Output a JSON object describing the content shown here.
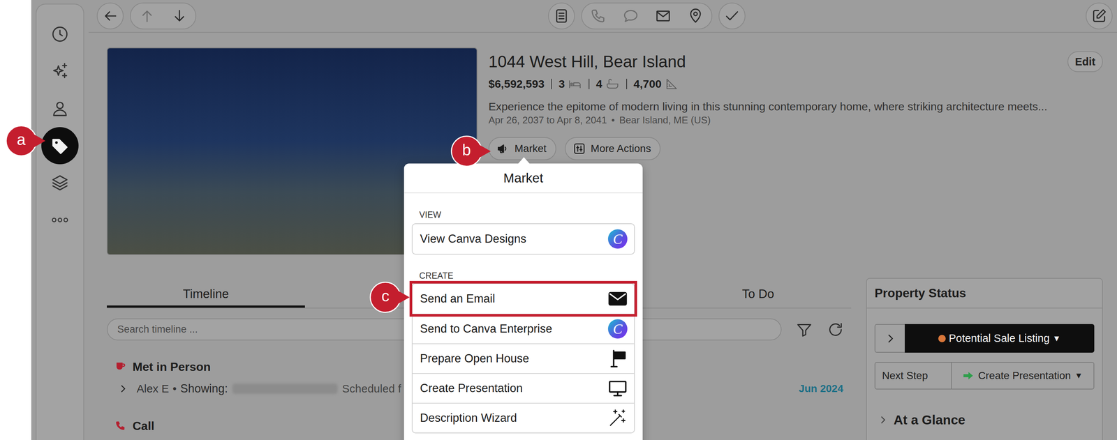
{
  "sidebar": {
    "items": [
      {
        "kind": "history",
        "selected": false
      },
      {
        "kind": "ai",
        "selected": false
      },
      {
        "kind": "contacts",
        "selected": false
      },
      {
        "kind": "properties",
        "selected": true
      },
      {
        "kind": "layers",
        "selected": false
      },
      {
        "kind": "more",
        "selected": false
      }
    ]
  },
  "toolbar": {
    "groups": [
      {
        "buttons": [
          {
            "kind": "back",
            "disabled": false
          }
        ]
      },
      {
        "buttons": [
          {
            "kind": "up",
            "disabled": true
          },
          {
            "kind": "down",
            "disabled": false
          }
        ]
      },
      {
        "buttons": [
          {
            "kind": "notes",
            "disabled": false
          }
        ]
      },
      {
        "buttons": [
          {
            "kind": "phone",
            "disabled": true
          },
          {
            "kind": "chat",
            "disabled": true
          },
          {
            "kind": "mail",
            "disabled": false
          },
          {
            "kind": "pin",
            "disabled": false
          }
        ]
      },
      {
        "buttons": [
          {
            "kind": "check",
            "disabled": false
          }
        ]
      },
      {
        "buttons": [
          {
            "kind": "compose",
            "disabled": false
          }
        ]
      }
    ]
  },
  "property": {
    "title": "1044 West Hill, Bear Island",
    "price": "$6,592,593",
    "stats": [
      {
        "kind": "beds",
        "value": "3"
      },
      {
        "kind": "baths",
        "value": "4"
      },
      {
        "kind": "area",
        "value": "4,700"
      }
    ],
    "description": "Experience the epitome of modern living in this stunning contemporary home, where striking architecture meets...",
    "dates": "Apr 26, 2037 to Apr 8, 2041",
    "separator": "•",
    "location": "Bear Island, ME (US)",
    "edit": "Edit",
    "actions": [
      {
        "kind": "market",
        "label": "Market"
      },
      {
        "kind": "more",
        "label": "More Actions"
      }
    ]
  },
  "tabs": [
    {
      "label": "Timeline",
      "selected": true
    },
    {
      "label": "To Do",
      "selected": false
    }
  ],
  "search": {
    "placeholder": "Search timeline ..."
  },
  "timeline": [
    {
      "kind": "meeting",
      "title": "Met in Person",
      "detail": {
        "expanded": false,
        "who": "Alex E",
        "separator": "•",
        "type": "Showing:",
        "note": "Scheduled f",
        "date": "Jun 2024"
      }
    },
    {
      "kind": "call",
      "title": "Call"
    }
  ],
  "property_status": {
    "title": "Property Status",
    "expanded": false,
    "status": {
      "label": "Potential Sale Listing",
      "caret": "▼",
      "color": "#d9773a"
    },
    "next_step": {
      "label": "Next Step",
      "value": "Create Presentation",
      "caret": "▼"
    }
  },
  "at_a_glance": {
    "label": "At a Glance",
    "expanded": false
  },
  "menu": {
    "title": "Market",
    "sections": [
      {
        "heading": "VIEW",
        "items": [
          {
            "kind": "canva",
            "label": "View Canva Designs",
            "badge": "C",
            "selected": false
          }
        ]
      },
      {
        "heading": "CREATE",
        "items": [
          {
            "kind": "email",
            "label": "Send an Email",
            "selected": true
          },
          {
            "kind": "canva",
            "label": "Send to Canva Enterprise",
            "badge": "C",
            "selected": false
          },
          {
            "kind": "open-house",
            "label": "Prepare Open House",
            "selected": false
          },
          {
            "kind": "presentation",
            "label": "Create Presentation",
            "selected": false
          },
          {
            "kind": "wizard",
            "label": "Description Wizard",
            "selected": false
          }
        ]
      }
    ]
  },
  "annotations": [
    {
      "label": "a"
    },
    {
      "label": "b"
    },
    {
      "label": "c"
    }
  ]
}
